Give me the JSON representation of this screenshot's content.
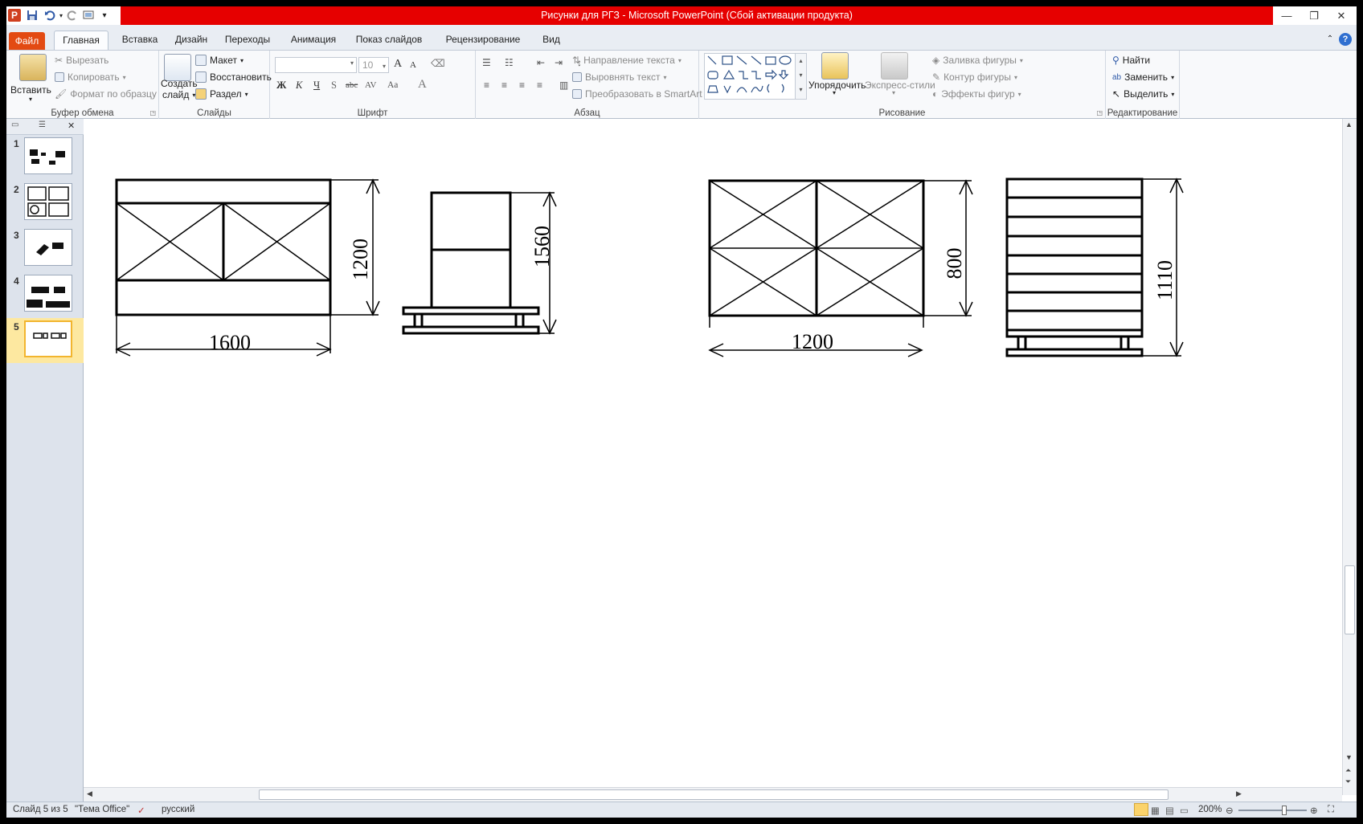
{
  "app": {
    "title": "Рисунки для РГЗ  -  Microsoft PowerPoint (Сбой активации продукта)",
    "accent": "#e60000",
    "file_tab_color": "#e34a12"
  },
  "quick_access": {
    "icons": [
      "powerpoint-logo-icon",
      "save-icon",
      "undo-icon",
      "redo-icon",
      "present-icon",
      "customize-icon"
    ],
    "logo_letter": "P"
  },
  "tabs": [
    {
      "label": "Файл"
    },
    {
      "label": "Главная"
    },
    {
      "label": "Вставка"
    },
    {
      "label": "Дизайн"
    },
    {
      "label": "Переходы"
    },
    {
      "label": "Анимация"
    },
    {
      "label": "Показ слайдов"
    },
    {
      "label": "Рецензирование"
    },
    {
      "label": "Вид"
    }
  ],
  "ribbon": {
    "clipboard": {
      "label": "Буфер обмена",
      "paste": "Вставить",
      "cut": "Вырезать",
      "copy": "Копировать",
      "format_painter": "Формат по образцу"
    },
    "slides": {
      "label": "Слайды",
      "new_slide_1": "Создать",
      "new_slide_2": "слайд",
      "layout": "Макет",
      "reset": "Восстановить",
      "section": "Раздел"
    },
    "font": {
      "label": "Шрифт",
      "font_name": "",
      "font_size": "10",
      "bold": "Ж",
      "italic": "К",
      "underline": "Ч",
      "shadow": "S",
      "strike": "abc",
      "spacing": "AV",
      "case": "Aa",
      "grow": "A",
      "shrink": "A",
      "color": "A"
    },
    "paragraph": {
      "label": "Абзац",
      "text_direction": "Направление текста",
      "align_text": "Выровнять текст",
      "smartart": "Преобразовать в SmartArt"
    },
    "drawing": {
      "label": "Рисование",
      "arrange": "Упорядочить",
      "quick_styles": "Экспресс-стили",
      "fill": "Заливка фигуры",
      "outline": "Контур фигуры",
      "effects": "Эффекты фигур"
    },
    "editing": {
      "label": "Редактирование",
      "find": "Найти",
      "replace": "Заменить",
      "select": "Выделить"
    }
  },
  "slides": [
    {
      "number": "1"
    },
    {
      "number": "2"
    },
    {
      "number": "3"
    },
    {
      "number": "4"
    },
    {
      "number": "5"
    }
  ],
  "drawings": {
    "dim_1": "1600",
    "dim_2": "1200",
    "dim_3": "1560",
    "dim_4": "1200",
    "dim_5": "800",
    "dim_6": "1110"
  },
  "status": {
    "slide": "Слайд 5 из 5",
    "theme": "\"Тема Office\"",
    "language": "русский",
    "zoom": "200%"
  }
}
